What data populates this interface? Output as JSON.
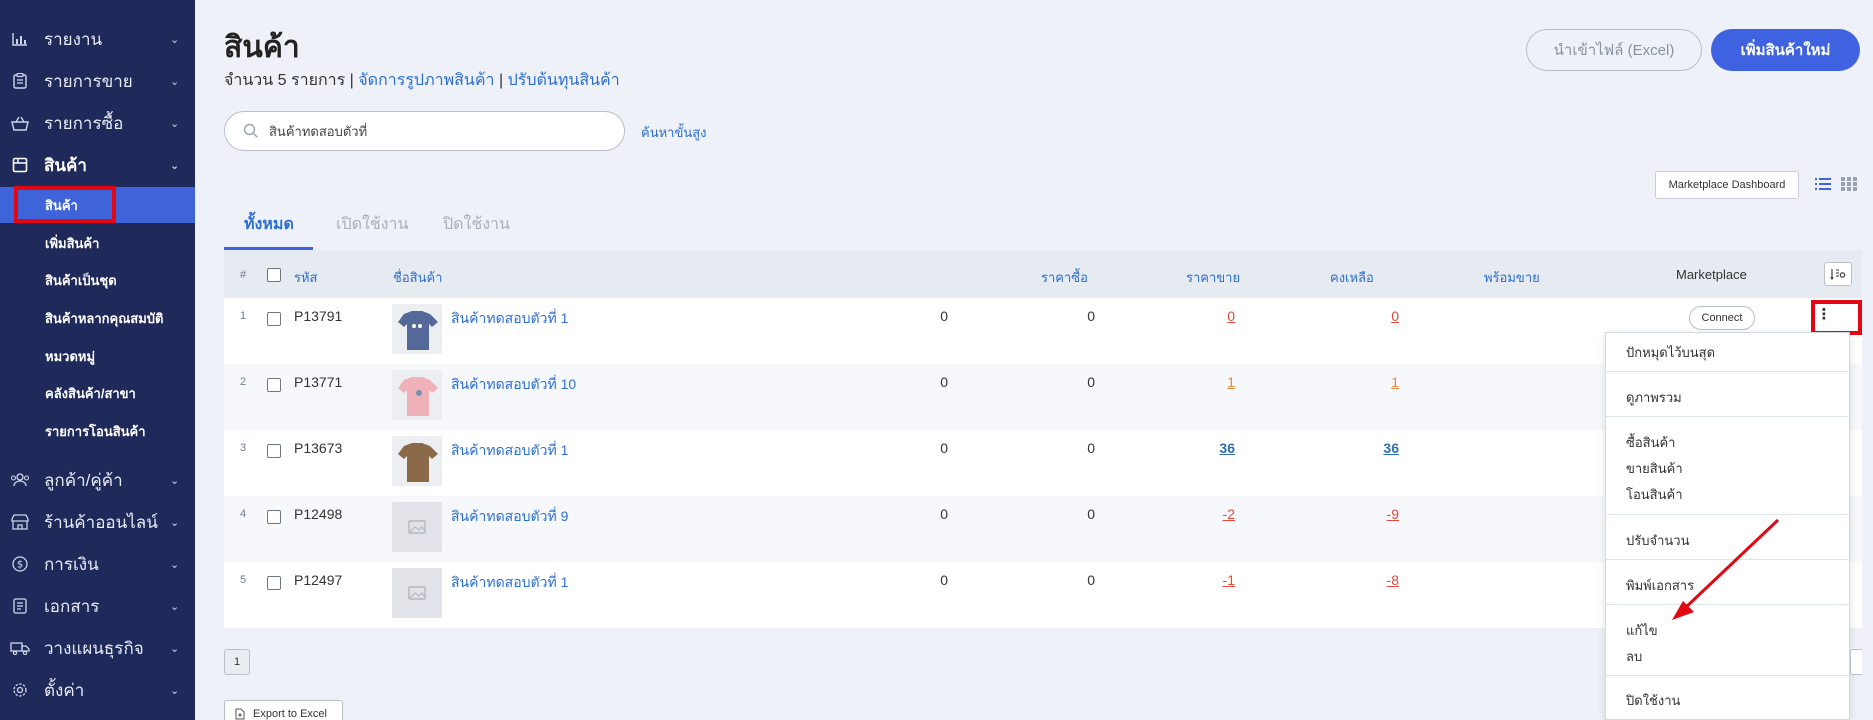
{
  "sidebar": {
    "items": [
      {
        "label": "รายงาน",
        "icon": "bar-chart-icon"
      },
      {
        "label": "รายการขาย",
        "icon": "clipboard-icon"
      },
      {
        "label": "รายการซื้อ",
        "icon": "basket-icon"
      },
      {
        "label": "สินค้า",
        "icon": "box-icon"
      },
      {
        "label": "ลูกค้า/คู่ค้า",
        "icon": "users-icon"
      },
      {
        "label": "ร้านค้าออนไลน์",
        "icon": "store-icon"
      },
      {
        "label": "การเงิน",
        "icon": "dollar-circle-icon"
      },
      {
        "label": "เอกสาร",
        "icon": "document-icon"
      },
      {
        "label": "วางแผนธุรกิจ",
        "icon": "truck-icon"
      },
      {
        "label": "ตั้งค่า",
        "icon": "gear-icon"
      }
    ],
    "product_sub": [
      "สินค้า",
      "เพิ่มสินค้า",
      "สินค้าเป็นชุด",
      "สินค้าหลากคุณสมบัติ",
      "หมวดหมู่",
      "คลังสินค้า/สาขา",
      "รายการโอนสินค้า"
    ]
  },
  "header": {
    "title": "สินค้า",
    "count_text": "จำนวน 5 รายการ |",
    "link_images": "จัดการรูปภาพสินค้า",
    "sep": "|",
    "link_cost": "ปรับต้นทุนสินค้า",
    "import_label": "นำเข้าไฟล์ (Excel)",
    "add_label": "เพิ่มสินค้าใหม่"
  },
  "search": {
    "value": "สินค้าทดสอบตัวที่",
    "advanced_label": "ค้นหาขั้นสูง"
  },
  "marketplace_dashboard_label": "Marketplace Dashboard",
  "tabs": [
    "ทั้งหมด",
    "เปิดใช้งาน",
    "ปิดใช้งาน"
  ],
  "table": {
    "headers": {
      "num": "#",
      "code": "รหัส",
      "name": "ชื่อสินค้า",
      "buy": "ราคาซื้อ",
      "sell": "ราคาขาย",
      "remain": "คงเหลือ",
      "ready": "พร้อมขาย",
      "marketplace": "Marketplace"
    },
    "rows": [
      {
        "n": "1",
        "code": "P13791",
        "name": "สินค้าทดสอบตัวที่ 1",
        "buy": "0",
        "sell": "0",
        "remain": "0",
        "ready": "0",
        "thumb": "navy-shirt"
      },
      {
        "n": "2",
        "code": "P13771",
        "name": "สินค้าทดสอบตัวที่ 10",
        "buy": "0",
        "sell": "0",
        "remain": "1",
        "ready": "1",
        "thumb": "pink-shirt"
      },
      {
        "n": "3",
        "code": "P13673",
        "name": "สินค้าทดสอบตัวที่ 1",
        "buy": "0",
        "sell": "0",
        "remain": "36",
        "ready": "36",
        "thumb": "brown-shirt"
      },
      {
        "n": "4",
        "code": "P12498",
        "name": "สินค้าทดสอบตัวที่ 9",
        "buy": "0",
        "sell": "0",
        "remain": "-2",
        "ready": "-9",
        "thumb": "placeholder"
      },
      {
        "n": "5",
        "code": "P12497",
        "name": "สินค้าทดสอบตัวที่ 1",
        "buy": "0",
        "sell": "0",
        "remain": "-1",
        "ready": "-8",
        "thumb": "placeholder"
      }
    ],
    "connect_label": "Connect"
  },
  "menu": {
    "pin": "ปักหมุดไว้บนสุด",
    "overview": "ดูภาพรวม",
    "buy": "ซื้อสินค้า",
    "sell": "ขายสินค้า",
    "transfer": "โอนสินค้า",
    "adjust": "ปรับจำนวน",
    "print": "พิมพ์เอกสาร",
    "edit": "แก้ไข",
    "delete": "ลบ",
    "disable": "ปิดใช้งาน"
  },
  "pager": {
    "page": "1"
  },
  "export_label": "Export to Excel",
  "colors": {
    "sidebar": "#1f2a5a",
    "accent": "#3f63e0",
    "highlight": "#e30613"
  }
}
